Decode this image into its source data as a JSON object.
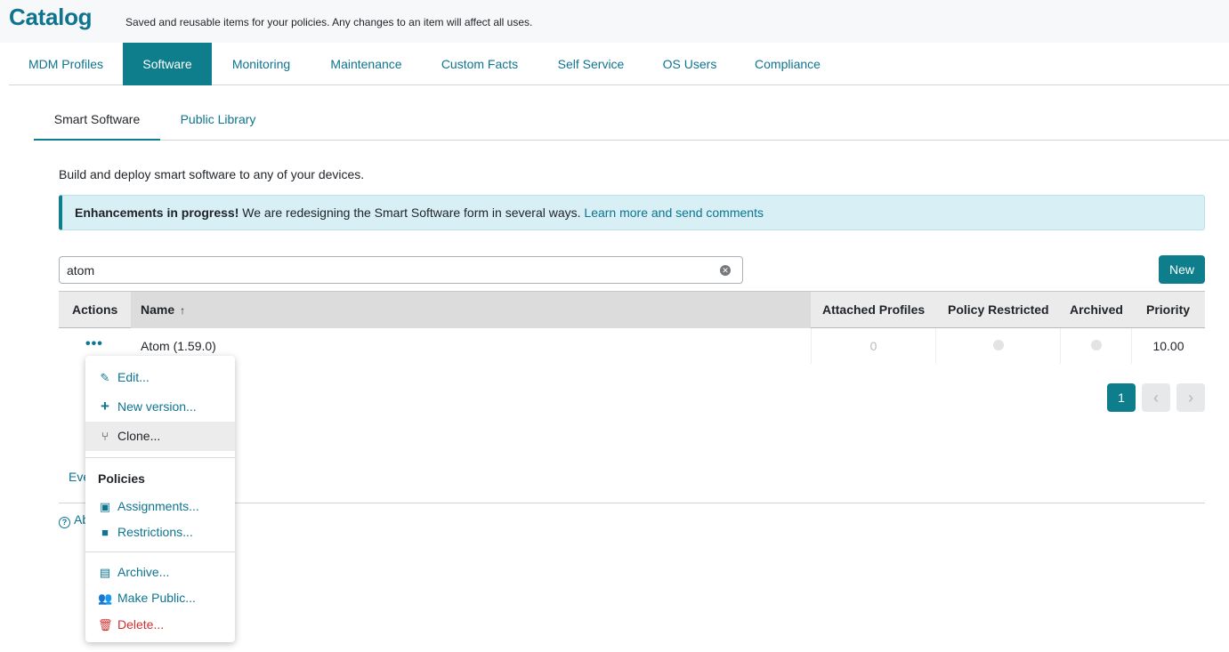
{
  "header": {
    "title": "Catalog",
    "subtitle": "Saved and reusable items for your policies. Any changes to an item will affect all uses."
  },
  "tabs": [
    {
      "label": "MDM Profiles"
    },
    {
      "label": "Software",
      "active": true
    },
    {
      "label": "Monitoring"
    },
    {
      "label": "Maintenance"
    },
    {
      "label": "Custom Facts"
    },
    {
      "label": "Self Service"
    },
    {
      "label": "OS Users"
    },
    {
      "label": "Compliance"
    }
  ],
  "subtabs": [
    {
      "label": "Smart Software",
      "active": true
    },
    {
      "label": "Public Library"
    }
  ],
  "description": "Build and deploy smart software to any of your devices.",
  "alert": {
    "bold": "Enhancements in progress!",
    "text": " We are redesigning the Smart Software form in several ways. ",
    "link": "Learn more and send comments"
  },
  "search": {
    "value": "atom",
    "clear_icon": "clear-icon"
  },
  "new_button": "New",
  "table": {
    "columns": [
      "Actions",
      "Name",
      "Attached Profiles",
      "Policy Restricted",
      "Archived",
      "Priority"
    ],
    "sort_indicator": "↑",
    "rows": [
      {
        "actions": "•••",
        "name": "Atom (1.59.0)",
        "attached_profiles": "0",
        "priority": "10.00"
      }
    ]
  },
  "pagination": {
    "current": "1",
    "prev": "‹",
    "next": "›"
  },
  "footer": {
    "events_link": "Eve",
    "about_link": "Ab"
  },
  "menu": {
    "edit": "Edit...",
    "new_version": "New version...",
    "clone": "Clone...",
    "policies_header": "Policies",
    "assignments": "Assignments...",
    "restrictions": "Restrictions...",
    "archive": "Archive...",
    "make_public": "Make Public...",
    "delete": "Delete..."
  },
  "colors": {
    "accent": "#0e7d8c",
    "link": "#0e7490",
    "danger": "#d0312d",
    "alert_bg": "#d7eff5"
  }
}
